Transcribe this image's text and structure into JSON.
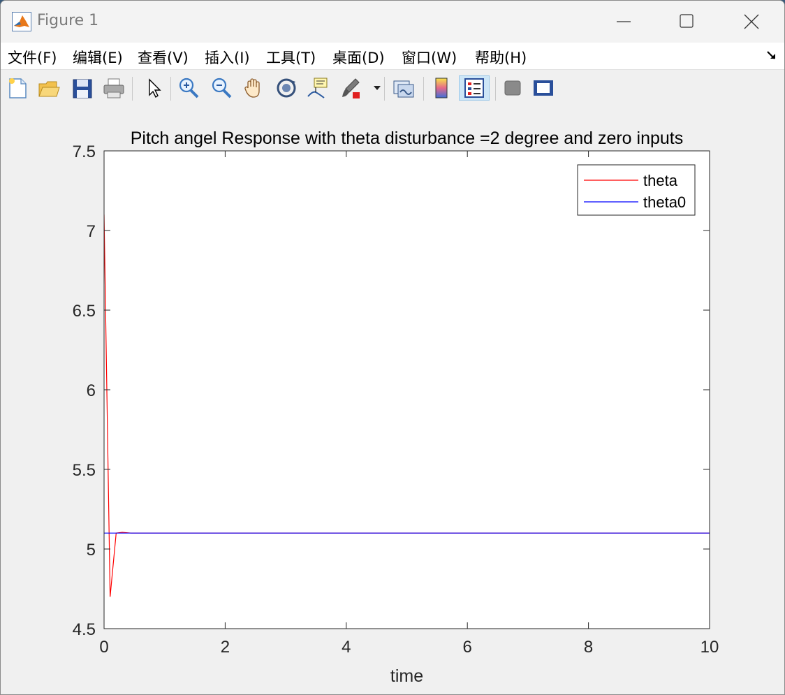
{
  "window": {
    "title": "Figure 1",
    "minimize_icon": "minimize-icon",
    "maximize_icon": "maximize-icon",
    "close_icon": "close-icon"
  },
  "menubar": {
    "items": [
      {
        "label": "文件(F)"
      },
      {
        "label": "编辑(E)"
      },
      {
        "label": "查看(V)"
      },
      {
        "label": "插入(I)"
      },
      {
        "label": "工具(T)"
      },
      {
        "label": "桌面(D)"
      },
      {
        "label": "窗口(W)"
      },
      {
        "label": "帮助(H)"
      }
    ],
    "dock_icon": "dock-arrow-icon"
  },
  "toolbar": {
    "buttons": [
      {
        "icon": "new-figure-icon"
      },
      {
        "icon": "open-folder-icon"
      },
      {
        "icon": "save-icon"
      },
      {
        "icon": "print-icon"
      },
      {
        "icon": "pointer-icon"
      },
      {
        "icon": "zoom-in-icon"
      },
      {
        "icon": "zoom-out-icon"
      },
      {
        "icon": "pan-hand-icon"
      },
      {
        "icon": "rotate-3d-icon"
      },
      {
        "icon": "data-cursor-icon"
      },
      {
        "icon": "brush-icon"
      },
      {
        "icon": "link-plot-icon"
      },
      {
        "icon": "colorbar-icon"
      },
      {
        "icon": "legend-icon",
        "active": true
      },
      {
        "icon": "hide-plot-tools-icon"
      },
      {
        "icon": "show-plot-tools-icon"
      }
    ],
    "colors": {
      "accent": "#0072bd",
      "brush_red": "#e02020"
    }
  },
  "chart_data": {
    "type": "line",
    "title": "Pitch angel Response with theta disturbance =2 degree and zero inputs",
    "xlabel": "time",
    "ylabel": "",
    "xlim": [
      0,
      10
    ],
    "ylim": [
      4.5,
      7.5
    ],
    "xticks": [
      0,
      2,
      4,
      6,
      8,
      10
    ],
    "yticks": [
      4.5,
      5,
      5.5,
      6,
      6.5,
      7,
      7.5
    ],
    "xtick_labels": [
      "0",
      "2",
      "4",
      "6",
      "8",
      "10"
    ],
    "ytick_labels": [
      "4.5",
      "5",
      "5.5",
      "6",
      "6.5",
      "7",
      "7.5"
    ],
    "grid": false,
    "legend_position": "top-right",
    "series": [
      {
        "name": "theta",
        "color": "#ff0000",
        "points": [
          [
            0,
            7.1
          ],
          [
            0.1,
            4.7
          ],
          [
            0.2,
            5.1
          ],
          [
            0.3,
            5.105
          ],
          [
            0.45,
            5.1
          ],
          [
            0.7,
            5.1
          ],
          [
            10,
            5.1
          ]
        ]
      },
      {
        "name": "theta0",
        "color": "#0000ff",
        "points": [
          [
            0,
            5.1
          ],
          [
            10,
            5.1
          ]
        ]
      }
    ]
  }
}
